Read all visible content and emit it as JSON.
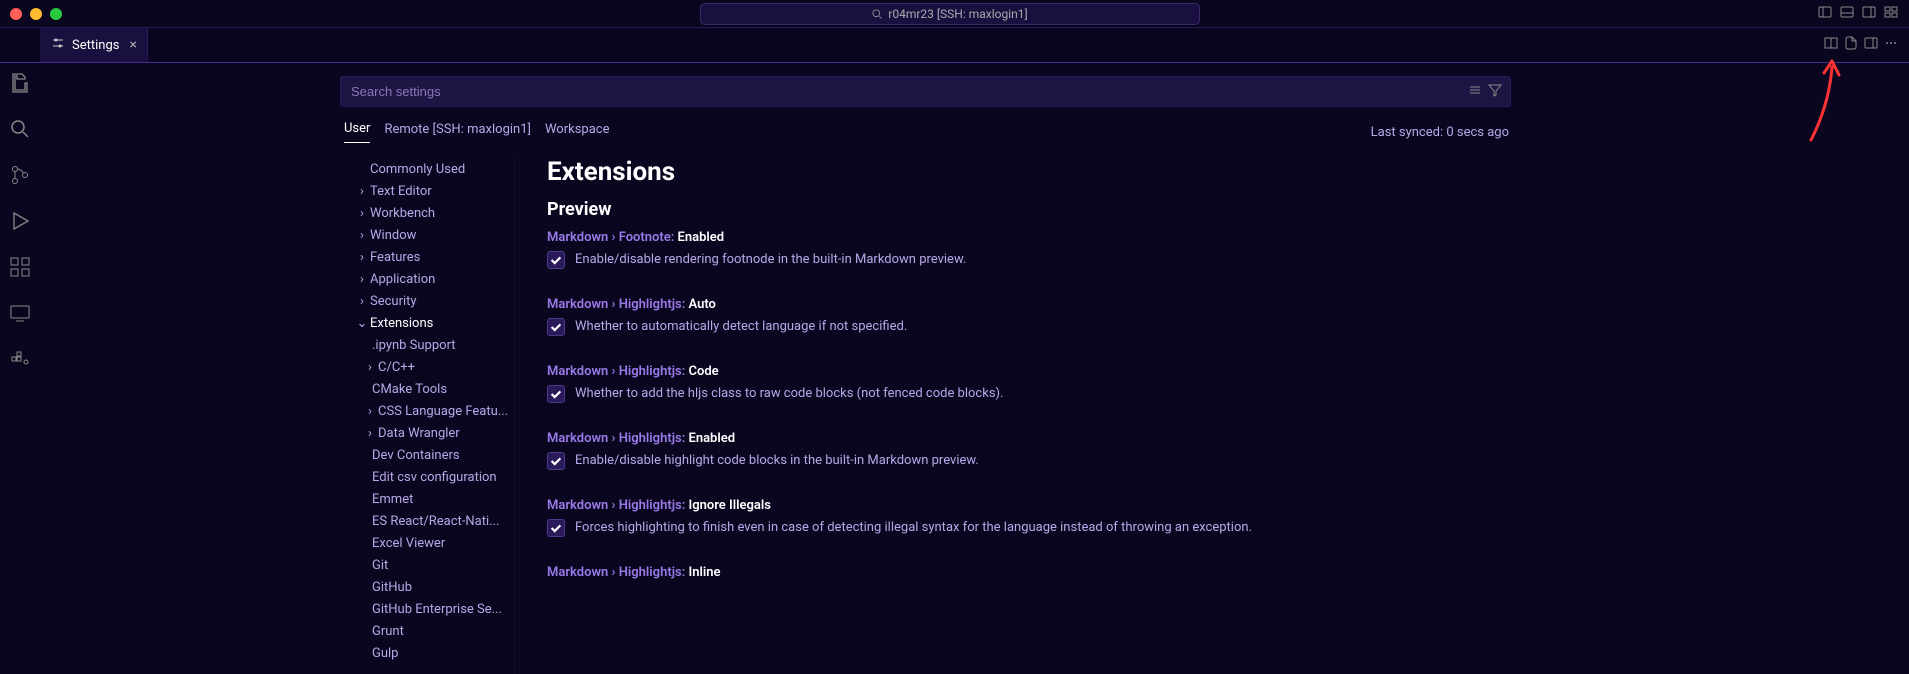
{
  "titlebar": {
    "host": "r04mr23 [SSH: maxlogin1]"
  },
  "tab": {
    "label": "Settings"
  },
  "search": {
    "placeholder": "Search settings"
  },
  "scopes": {
    "user": "User",
    "remote": "Remote [SSH: maxlogin1]",
    "workspace": "Workspace",
    "sync": "Last synced: 0 secs ago"
  },
  "tree": {
    "commonly_used": "Commonly Used",
    "text_editor": "Text Editor",
    "workbench": "Workbench",
    "window": "Window",
    "features": "Features",
    "application": "Application",
    "security": "Security",
    "extensions": "Extensions",
    "ext": {
      "ipynb": ".ipynb Support",
      "cpp": "C/C++",
      "cmake": "CMake Tools",
      "css": "CSS Language Featu...",
      "dw": "Data Wrangler",
      "devc": "Dev Containers",
      "editcsv": "Edit csv configuration",
      "emmet": "Emmet",
      "esreact": "ES React/React-Nati...",
      "excel": "Excel Viewer",
      "git": "Git",
      "github": "GitHub",
      "ghe": "GitHub Enterprise Se...",
      "grunt": "Grunt",
      "gulp": "Gulp"
    }
  },
  "headers": {
    "extensions": "Extensions",
    "preview": "Preview"
  },
  "settings": {
    "s1": {
      "path": "Markdown › Footnote:",
      "key": " Enabled",
      "desc": "Enable/disable rendering footnode in the built-in Markdown preview."
    },
    "s2": {
      "path": "Markdown › Highlightjs:",
      "key": " Auto",
      "desc": "Whether to automatically detect language if not specified."
    },
    "s3": {
      "path": "Markdown › Highlightjs:",
      "key": " Code",
      "desc": "Whether to add the hljs class to raw code blocks (not fenced code blocks)."
    },
    "s4": {
      "path": "Markdown › Highlightjs:",
      "key": " Enabled",
      "desc": "Enable/disable highlight code blocks in the built-in Markdown preview."
    },
    "s5": {
      "path": "Markdown › Highlightjs:",
      "key": " Ignore Illegals",
      "desc": "Forces highlighting to finish even in case of detecting illegal syntax for the language instead of throwing an exception."
    },
    "s6": {
      "path": "Markdown › Highlightjs:",
      "key": " Inline"
    }
  }
}
